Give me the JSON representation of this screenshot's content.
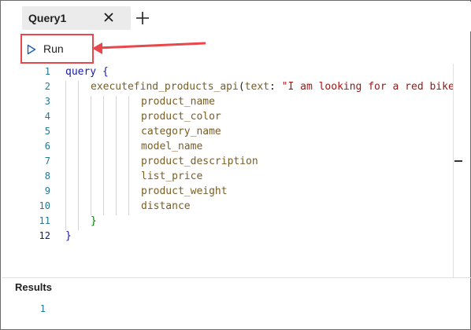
{
  "tabs": [
    {
      "label": "Query1"
    }
  ],
  "toolbar": {
    "run_label": "Run"
  },
  "editor": {
    "line_numbers": [
      "1",
      "2",
      "3",
      "4",
      "5",
      "6",
      "7",
      "8",
      "9",
      "10",
      "11",
      "12"
    ],
    "lines": {
      "l1_kw": "query",
      "l1_brace": "{",
      "l2_fn": "executefind_products_api",
      "l2_paren": "(",
      "l2_arg": "text",
      "l2_colon": ": ",
      "l2_str": "\"I am looking for a red bike",
      "fields": [
        "product_name",
        "product_color",
        "category_name",
        "model_name",
        "product_description",
        "list_price",
        "product_weight",
        "distance"
      ],
      "l11_brace": "}",
      "l12_brace": "}"
    }
  },
  "results": {
    "title": "Results",
    "row_numbers": [
      "1"
    ]
  },
  "colors": {
    "highlight": "#e8474c",
    "line_number": "#237893",
    "string": "#a31515",
    "keyword": "#1a1aa6"
  },
  "icons": {
    "close": "close-icon",
    "add": "plus-icon",
    "run": "play-icon"
  }
}
